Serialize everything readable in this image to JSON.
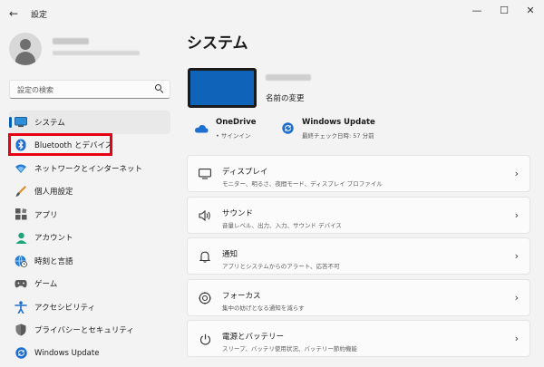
{
  "window": {
    "title": "設定",
    "back_glyph": "←",
    "minimize_glyph": "—",
    "maximize_glyph": "☐",
    "close_glyph": "✕"
  },
  "search": {
    "placeholder": "設定の検索"
  },
  "sidebar": {
    "items": [
      {
        "label": "システム",
        "icon": "monitor-icon"
      },
      {
        "label": "Bluetooth とデバイス",
        "icon": "bluetooth-icon"
      },
      {
        "label": "ネットワークとインターネット",
        "icon": "wifi-icon"
      },
      {
        "label": "個人用設定",
        "icon": "brush-icon"
      },
      {
        "label": "アプリ",
        "icon": "apps-icon"
      },
      {
        "label": "アカウント",
        "icon": "account-icon"
      },
      {
        "label": "時刻と言語",
        "icon": "globe-clock-icon"
      },
      {
        "label": "ゲーム",
        "icon": "gamepad-icon"
      },
      {
        "label": "アクセシビリティ",
        "icon": "accessibility-icon"
      },
      {
        "label": "プライバシーとセキュリティ",
        "icon": "shield-icon"
      },
      {
        "label": "Windows Update",
        "icon": "update-icon"
      }
    ],
    "selected_index": 0,
    "highlighted_index": 1
  },
  "main": {
    "title": "システム",
    "rename_label": "名前の変更",
    "quick": {
      "onedrive": {
        "title": "OneDrive",
        "status": "• サインイン"
      },
      "update": {
        "title": "Windows Update",
        "status": "最終チェック日時: 57 分前"
      }
    },
    "cards": [
      {
        "title": "ディスプレイ",
        "subtitle": "モニター、明るさ、夜間モード、ディスプレイ プロファイル",
        "icon": "display-icon"
      },
      {
        "title": "サウンド",
        "subtitle": "音量レベル、出力、入力、サウンド デバイス",
        "icon": "speaker-icon"
      },
      {
        "title": "通知",
        "subtitle": "アプリとシステムからのアラート、応答不可",
        "icon": "bell-icon"
      },
      {
        "title": "フォーカス",
        "subtitle": "集中の妨げとなる通知を減らす",
        "icon": "focus-icon"
      },
      {
        "title": "電源とバッテリー",
        "subtitle": "スリープ、バッテリ使用状況、バッテリー節約機能",
        "icon": "power-icon"
      }
    ],
    "chevron": "›"
  },
  "colors": {
    "accent": "#005fb8",
    "highlight": "#e60012",
    "device_thumb": "#0f63b8"
  }
}
